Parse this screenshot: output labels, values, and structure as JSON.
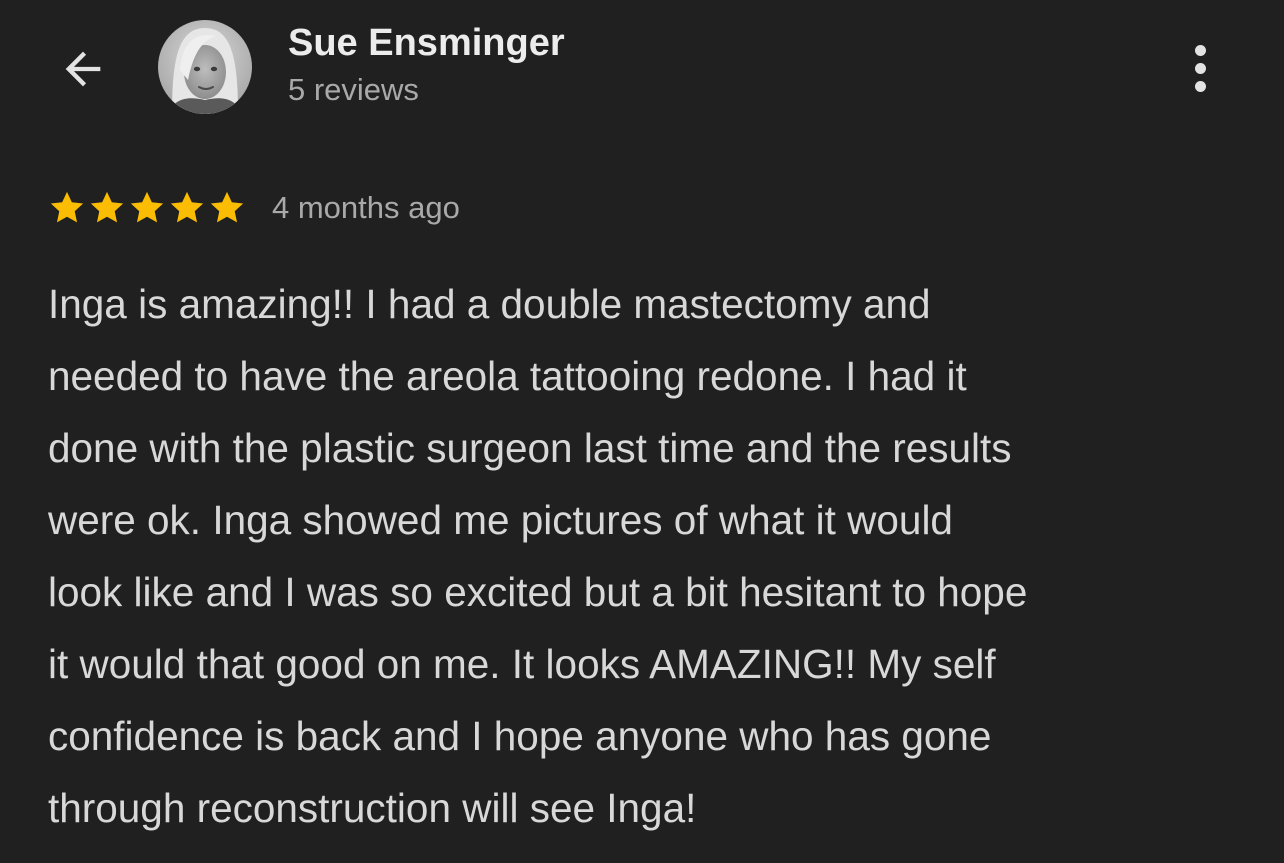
{
  "header": {
    "back_icon": "arrow-left-icon",
    "reviewer_name": "Sue Ensminger",
    "reviews_count": "5 reviews",
    "more_icon": "more-vertical-icon"
  },
  "review": {
    "rating": 5,
    "rating_max": 5,
    "star_color": "#fbbc04",
    "date": "4 months ago",
    "text_lines": [
      "Inga is amazing!! I had a double mastectomy and",
      "needed to have the areola tattooing redone. I had it",
      "done with the plastic surgeon last time and the results",
      "were ok. Inga showed me pictures of what it would",
      "look like and I was so excited but a bit hesitant to hope",
      "it would that good on me. It looks AMAZING!! My self",
      "confidence is back and I hope anyone who has gone",
      "through reconstruction will see Inga!"
    ]
  },
  "colors": {
    "background": "#202020",
    "primary_text": "#ececec",
    "secondary_text": "#a9a9a9",
    "body_text": "#d8d8d8"
  }
}
